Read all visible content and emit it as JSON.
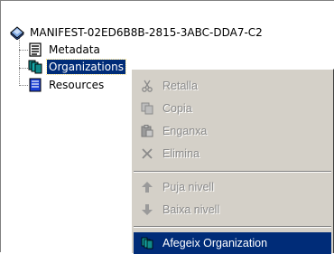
{
  "tree": {
    "root_label": "MANIFEST-02ED6B8B-2815-3ABC-DDA7-C2",
    "children": [
      {
        "label": "Metadata",
        "icon": "metadata-icon"
      },
      {
        "label": "Organizations",
        "icon": "organizations-icon",
        "selected": true
      },
      {
        "label": "Resources",
        "icon": "resources-icon"
      }
    ]
  },
  "context_menu": {
    "items": [
      {
        "label": "Retalla",
        "icon": "scissors-icon",
        "enabled": false
      },
      {
        "label": "Copia",
        "icon": "copy-icon",
        "enabled": false
      },
      {
        "label": "Enganxa",
        "icon": "paste-icon",
        "enabled": false
      },
      {
        "label": "Elimina",
        "icon": "delete-x-icon",
        "enabled": false
      },
      {
        "label": "Puja nivell",
        "icon": "arrow-up-icon",
        "enabled": false
      },
      {
        "label": "Baixa nivell",
        "icon": "arrow-down-icon",
        "enabled": false
      },
      {
        "label": "Afegeix Organization",
        "icon": "organization-icon",
        "enabled": true,
        "highlighted": true
      }
    ]
  },
  "colors": {
    "selection": "#002c78",
    "menu_background": "#d4d0c8",
    "disabled_text": "#8a8a8a",
    "icon_teal": "#0f8a8a",
    "icon_blue": "#1c3fd6"
  }
}
